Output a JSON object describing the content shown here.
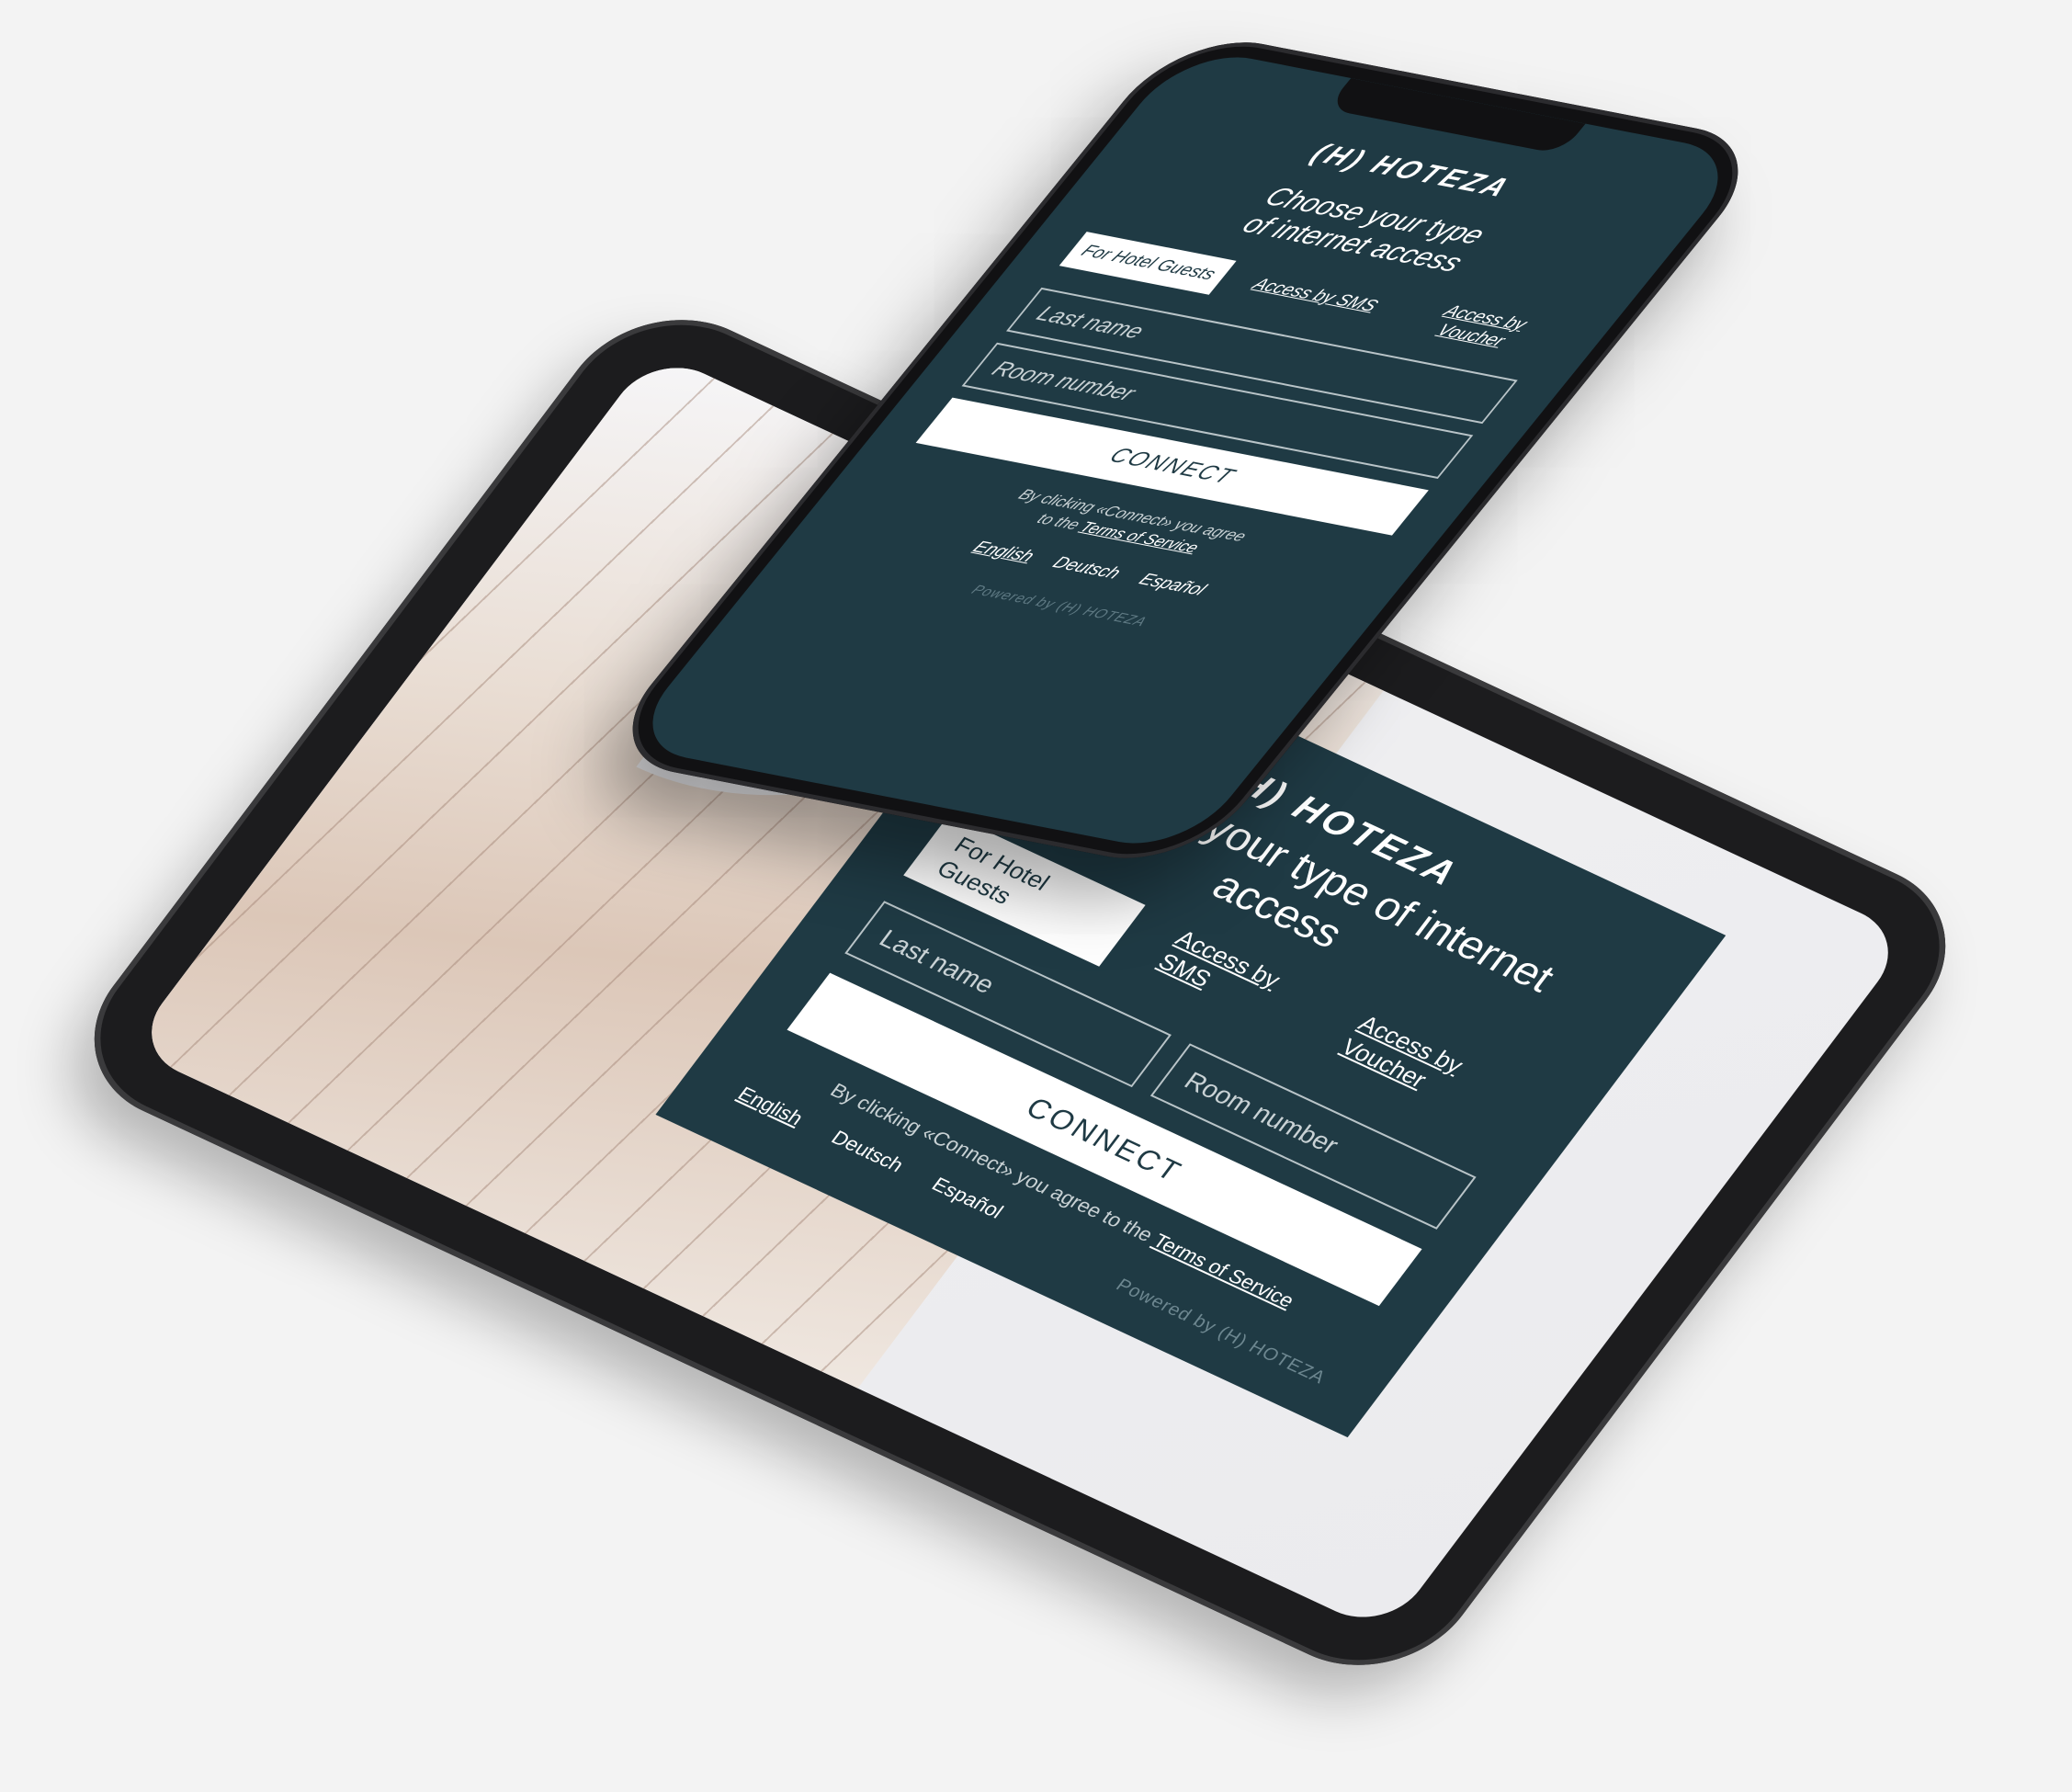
{
  "brand": {
    "logo_text": "(H) HOTEZA",
    "powered_by": "Powered by (H) HOTEZA"
  },
  "portal": {
    "title": "Choose your type of internet access",
    "tabs": [
      {
        "label": "For Hotel Guests"
      },
      {
        "label": "Access by SMS"
      },
      {
        "label": "Access by Voucher"
      }
    ],
    "fields": {
      "last_name_placeholder": "Last name",
      "room_number_placeholder": "Room number"
    },
    "connect_label": "CONNECT",
    "terms_prefix": "By clicking «Connect» you agree to the",
    "terms_link": "Terms of Service",
    "languages": [
      "English",
      "Deutsch",
      "Español"
    ]
  },
  "mobile": {
    "title_line1": "Choose your type",
    "title_line2": "of internet access",
    "tabs": [
      {
        "label": "For Hotel Guests"
      },
      {
        "label": "Access by SMS"
      },
      {
        "label": "Access by Voucher"
      }
    ],
    "last_name_placeholder": "Last name",
    "room_number_placeholder": "Room number",
    "connect_label": "CONNECT",
    "terms_line1": "By clicking «Connect» you agree",
    "terms_line2_prefix": "to the",
    "terms_link": "Terms of Service",
    "languages": [
      "English",
      "Deutsch",
      "Español"
    ]
  },
  "colors": {
    "portal_bg": "#1f3a44",
    "page_bg": "#f3f3f3"
  }
}
